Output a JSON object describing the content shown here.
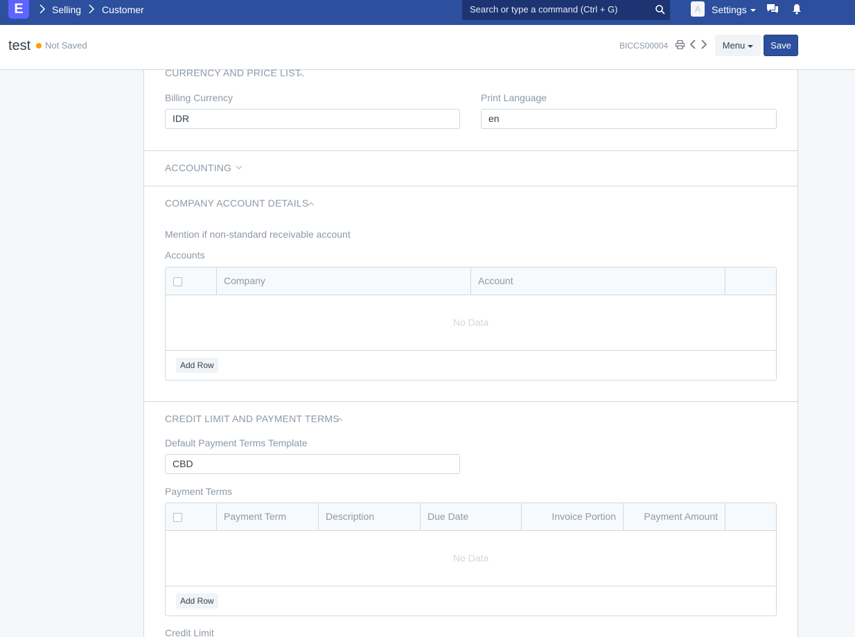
{
  "navbar": {
    "logo": "E",
    "breadcrumbs": [
      "Selling",
      "Customer"
    ],
    "search_placeholder": "Search or type a command (Ctrl + G)",
    "avatar_letter": "A",
    "settings_label": "Settings"
  },
  "page_head": {
    "title": "test",
    "status": "Not Saved",
    "doc_name": "BICCS00004",
    "menu_label": "Menu",
    "save_label": "Save",
    "status_color": "#ffa00a",
    "primary_color": "#2c4f9e"
  },
  "sections": {
    "currency": {
      "title": "CURRENCY AND PRICE LIST",
      "billing_currency_label": "Billing Currency",
      "billing_currency_value": "IDR",
      "print_language_label": "Print Language",
      "print_language_value": "en"
    },
    "accounting": {
      "title": "ACCOUNTING"
    },
    "company_accounts": {
      "title": "COMPANY ACCOUNT DETAILS",
      "help": "Mention if non-standard receivable account",
      "accounts_label": "Accounts",
      "columns": [
        "Company",
        "Account"
      ],
      "empty": "No Data",
      "add_row": "Add Row"
    },
    "credit": {
      "title": "CREDIT LIMIT AND PAYMENT TERMS",
      "template_label": "Default Payment Terms Template",
      "template_value": "CBD",
      "payment_terms_label": "Payment Terms",
      "columns": [
        "Payment Term",
        "Description",
        "Due Date",
        "Invoice Portion",
        "Payment Amount"
      ],
      "empty": "No Data",
      "add_row": "Add Row",
      "credit_limit_label": "Credit Limit"
    }
  }
}
